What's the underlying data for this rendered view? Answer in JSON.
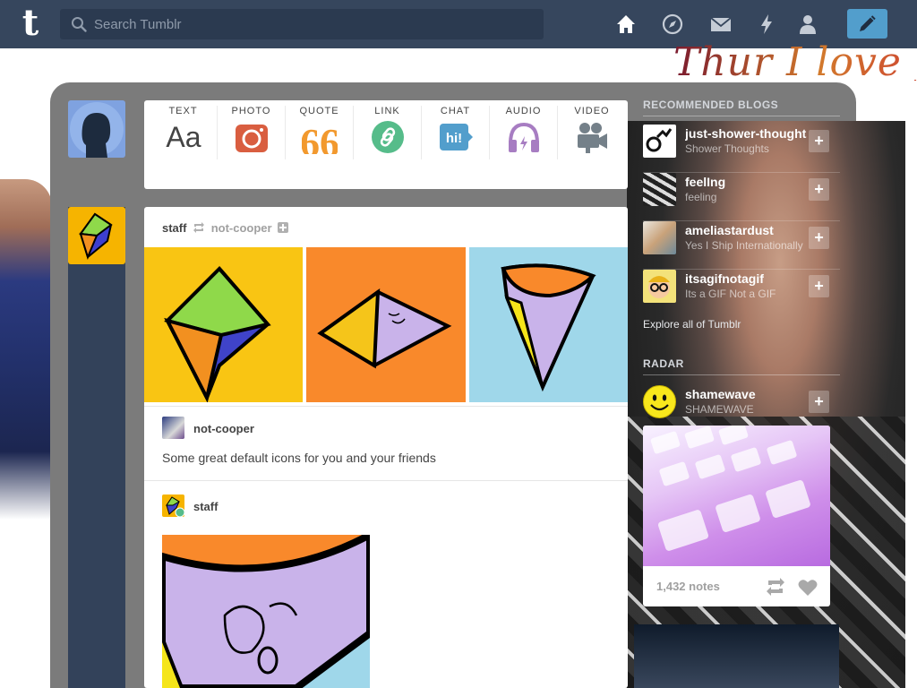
{
  "header": {
    "logo": "t",
    "search_placeholder": "Search Tumblr",
    "nav": [
      {
        "name": "home-icon"
      },
      {
        "name": "explore-icon"
      },
      {
        "name": "inbox-icon"
      },
      {
        "name": "activity-icon"
      },
      {
        "name": "account-icon"
      }
    ],
    "compose_icon": "pencil-icon"
  },
  "background_text": "Thur I love yo",
  "post_types": [
    {
      "label": "TEXT",
      "icon": "text-icon",
      "glyph": "Aa",
      "color": "#444444"
    },
    {
      "label": "PHOTO",
      "icon": "camera-icon",
      "color": "#d95e40"
    },
    {
      "label": "QUOTE",
      "icon": "quote-icon",
      "glyph": "66",
      "color": "#f2992e"
    },
    {
      "label": "LINK",
      "icon": "link-icon",
      "color": "#56bc8a"
    },
    {
      "label": "CHAT",
      "icon": "chat-icon",
      "glyph": "hi!",
      "color": "#529ecc"
    },
    {
      "label": "AUDIO",
      "icon": "headphones-icon",
      "color": "#a77dc2"
    },
    {
      "label": "VIDEO",
      "icon": "video-camera-icon",
      "color": "#748089"
    }
  ],
  "post": {
    "author": "staff",
    "reblogged_from": "not-cooper",
    "tile_colors": [
      "#f9c513",
      "#f9892b",
      "#9fd7ea"
    ],
    "source": {
      "user": "not-cooper",
      "caption": "Some great default icons for you and your friends"
    },
    "reblog": {
      "user": "staff"
    }
  },
  "sidebar": {
    "recommended_heading": "RECOMMENDED BLOGS",
    "blogs": [
      {
        "name": "just-shower-thoughts",
        "title": "Shower Thoughts"
      },
      {
        "name": "feelIng",
        "title": "feeling"
      },
      {
        "name": "ameliastardust",
        "title": "Yes I Ship Internationally"
      },
      {
        "name": "itsagifnotagif",
        "title": "Its a GIF Not a GIF"
      }
    ],
    "explore_link": "Explore all of Tumblr",
    "radar_heading": "RADAR",
    "radar": {
      "name": "shamewave",
      "title": "SHAMEWAVE",
      "notes": "1,432 notes"
    }
  }
}
